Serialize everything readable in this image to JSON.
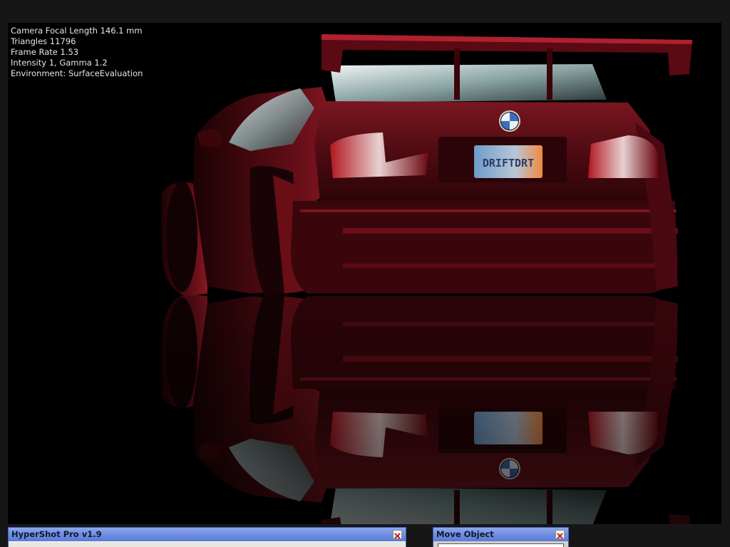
{
  "viewport": {
    "hud": [
      "Camera Focal Length 146.1 mm",
      "Triangles 11796",
      "Frame Rate 1.53",
      "Intensity 1, Gamma 1.2",
      "Environment: SurfaceEvaluation"
    ],
    "plate_text": "DRIFTDRT"
  },
  "panels": {
    "hypershot": {
      "title": "HyperShot Pro v1.9"
    },
    "move_object": {
      "title": "Move Object"
    }
  },
  "colors": {
    "paint": "#5a0c12",
    "paint_highlight": "#b0202c",
    "titlebar": "#6f8ee0"
  },
  "icons": {
    "close": "close-icon"
  }
}
